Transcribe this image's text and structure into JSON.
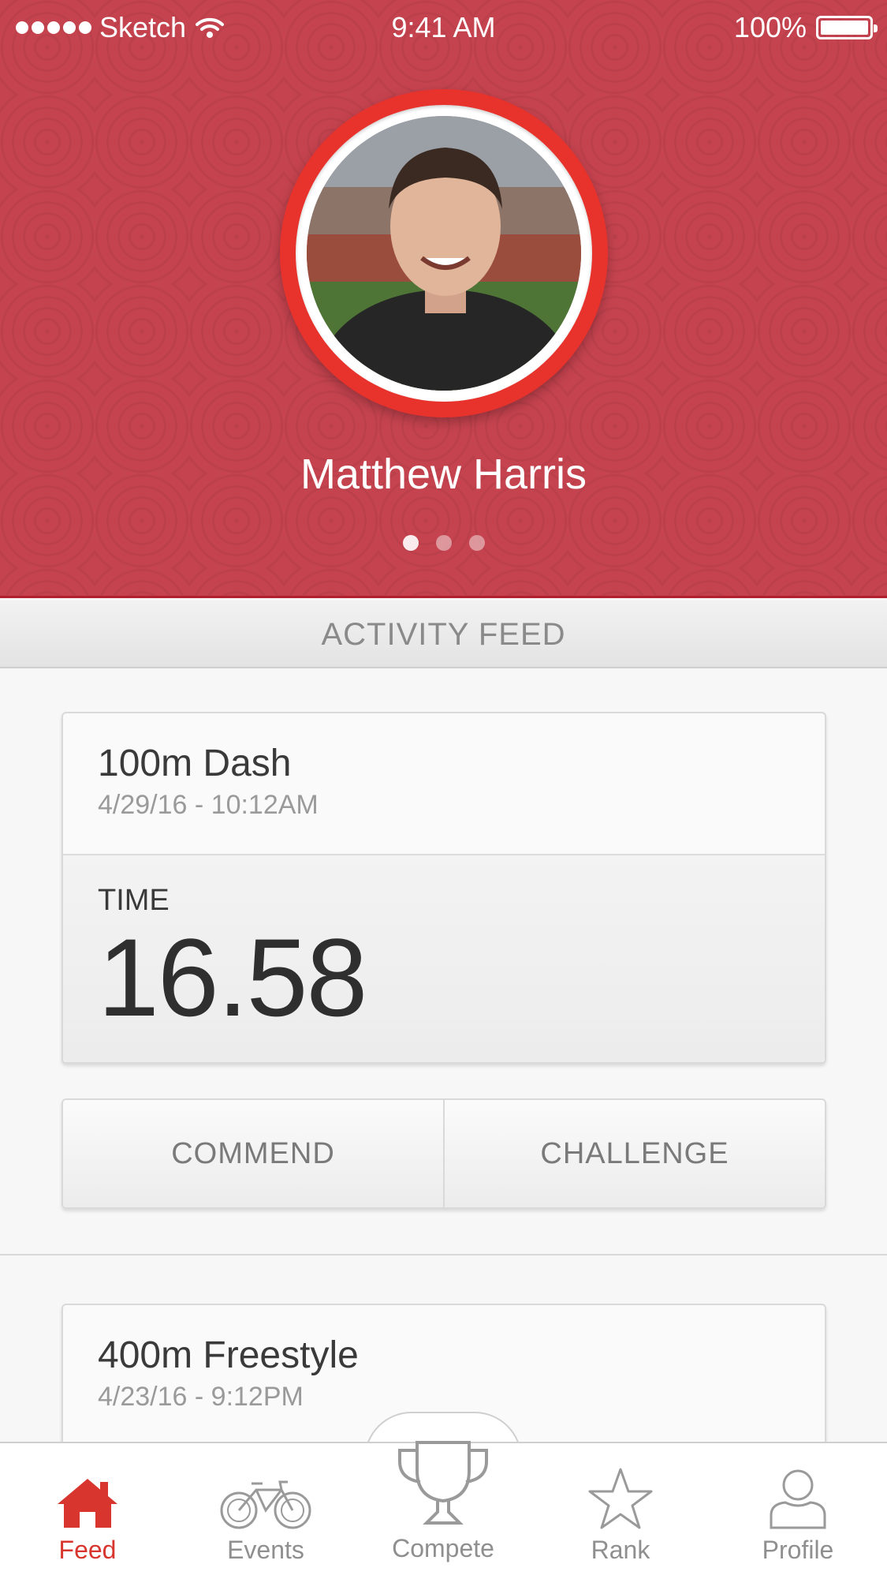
{
  "status_bar": {
    "carrier": "Sketch",
    "time": "9:41 AM",
    "battery": "100%"
  },
  "profile": {
    "name": "Matthew Harris",
    "page_count": 3,
    "active_page": 1
  },
  "feed": {
    "header": "ACTIVITY FEED",
    "cards": [
      {
        "title": "100m Dash",
        "date": "4/29/16 - 10:12AM",
        "metric_label": "TIME",
        "metric_value": "16.58",
        "actions": [
          "COMMEND",
          "CHALLENGE"
        ]
      },
      {
        "title": "400m Freestyle",
        "date": "4/23/16 - 9:12PM"
      }
    ]
  },
  "tab_bar": {
    "tabs": [
      {
        "label": "Feed",
        "icon": "home-icon",
        "active": true
      },
      {
        "label": "Events",
        "icon": "bicycle-icon",
        "active": false
      },
      {
        "label": "Compete",
        "icon": "trophy-icon",
        "active": false
      },
      {
        "label": "Rank",
        "icon": "star-icon",
        "active": false
      },
      {
        "label": "Profile",
        "icon": "person-icon",
        "active": false
      }
    ]
  },
  "colors": {
    "brand_red": "#c5434f",
    "accent_red": "#e8322c",
    "active_tab": "#d7352d",
    "inactive_tab": "#8f8f8f"
  }
}
